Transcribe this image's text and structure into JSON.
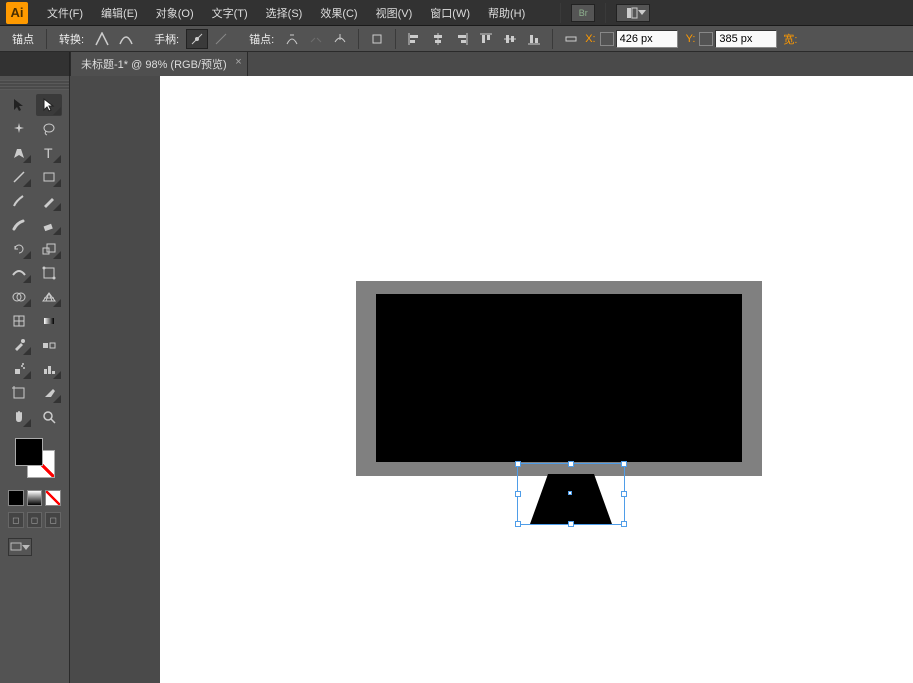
{
  "app": {
    "logo_text": "Ai"
  },
  "menu": {
    "file": "文件(F)",
    "edit": "编辑(E)",
    "object": "对象(O)",
    "type": "文字(T)",
    "select": "选择(S)",
    "effect": "效果(C)",
    "view": "视图(V)",
    "window": "窗口(W)",
    "help": "帮助(H)",
    "br_label": "Br"
  },
  "options": {
    "anchor_label": "锚点",
    "convert_label": "转换:",
    "handle_label": "手柄:",
    "anchor2_label": "锚点:",
    "x_label": "X:",
    "x_value": "426 px",
    "y_label": "Y:",
    "y_value": "385 px",
    "width_label": "宽:"
  },
  "document": {
    "tab_title": "未标题-1* @ 98% (RGB/预览)",
    "close_glyph": "×"
  },
  "toolbox": {
    "swatch": {
      "fill": "#000000",
      "stroke": "none"
    }
  },
  "artwork": {
    "monitor_frame_color": "#808080",
    "monitor_screen_color": "#000000",
    "trapezoid_color": "#000000",
    "selection_color": "#4f9de8"
  }
}
